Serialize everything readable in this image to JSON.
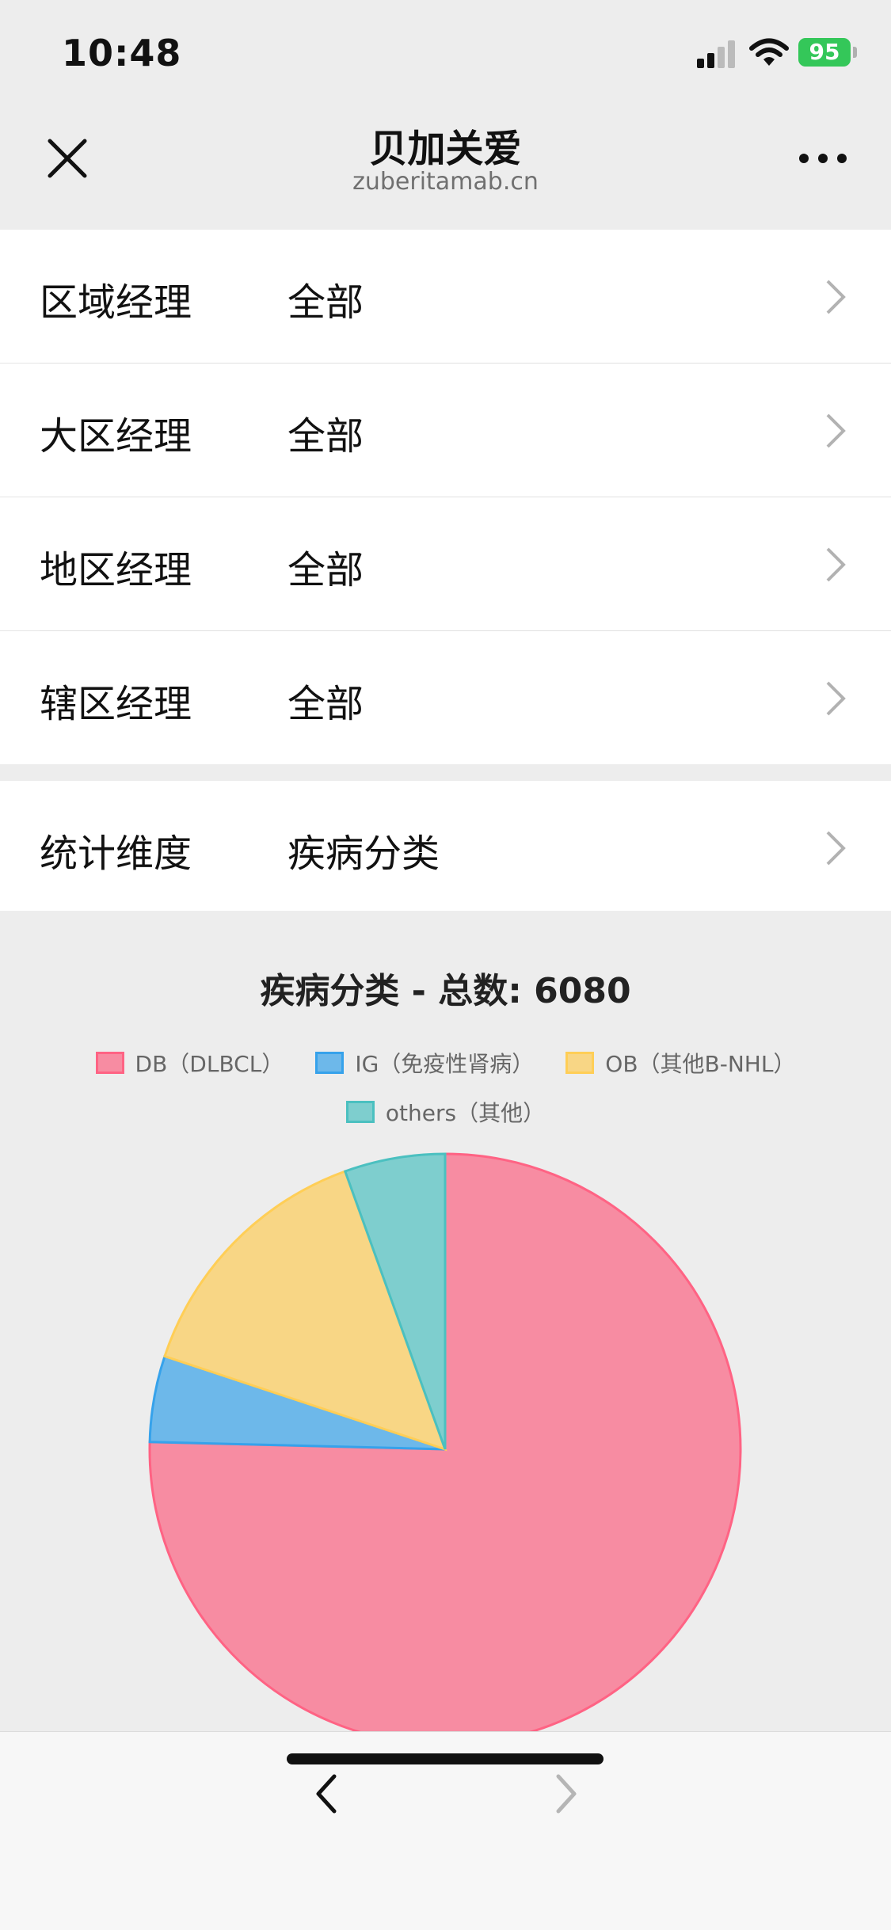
{
  "status_bar": {
    "time": "10:48",
    "battery": "95"
  },
  "nav": {
    "title": "贝加关爱",
    "subtitle": "zuberitamab.cn"
  },
  "filters": [
    {
      "label": "区域经理",
      "value": "全部"
    },
    {
      "label": "大区经理",
      "value": "全部"
    },
    {
      "label": "地区经理",
      "value": "全部"
    },
    {
      "label": "辖区经理",
      "value": "全部"
    }
  ],
  "dimension": {
    "label": "统计维度",
    "value": "疾病分类"
  },
  "chart_data": {
    "type": "pie",
    "title": "疾病分类 - 总数: 6080",
    "categories": [
      "DB（DLBCL）",
      "IG（免疫性肾病）",
      "OB（其他B-NHL）",
      "others（其他）"
    ],
    "values": [
      4584,
      286,
      876,
      334
    ],
    "colors": {
      "fill": [
        "#f78ca2",
        "#6db8ea",
        "#f8d685",
        "#7ecece"
      ],
      "stroke": [
        "#ff6384",
        "#36a2eb",
        "#ffce56",
        "#4bc0c0"
      ]
    },
    "legend_position": "top"
  },
  "icons": {
    "close": "close-icon",
    "more": "more-icon",
    "chevron": "chevron-right-icon",
    "back": "back-arrow-icon",
    "forward": "forward-arrow-icon"
  }
}
